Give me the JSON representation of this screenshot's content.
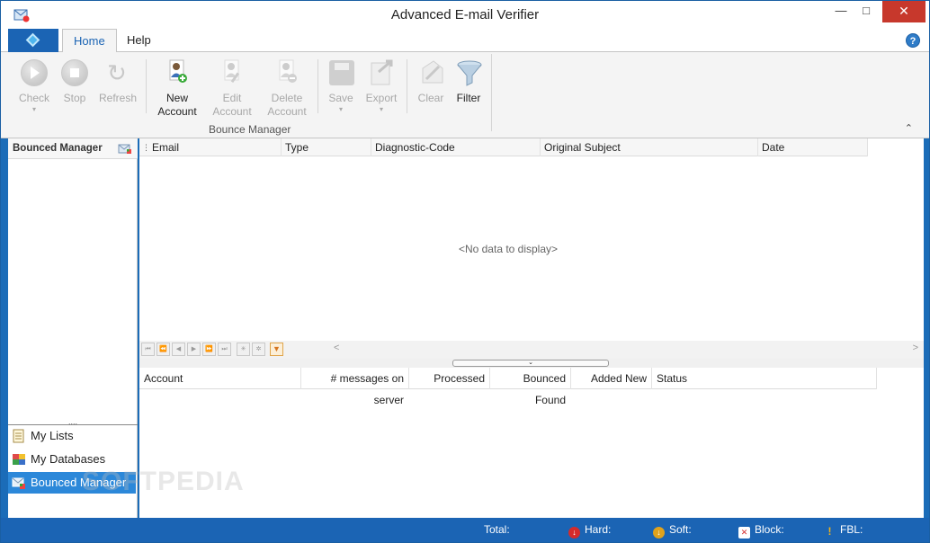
{
  "window": {
    "title": "Advanced E-mail Verifier",
    "min_glyph": "—",
    "max_glyph": "□",
    "close_glyph": "✕"
  },
  "ribbon": {
    "tabs": [
      "Home",
      "Help"
    ],
    "help_glyph": "?",
    "buttons": {
      "check": "Check",
      "stop": "Stop",
      "refresh": "Refresh",
      "new_account_1": "New",
      "new_account_2": "Account",
      "edit_account_1": "Edit",
      "edit_account_2": "Account",
      "delete_account_1": "Delete",
      "delete_account_2": "Account",
      "save": "Save",
      "export": "Export",
      "clear": "Clear",
      "filter": "Filter"
    },
    "group_label": "Bounce Manager",
    "caret_glyph": "▾",
    "collapse_glyph": "⌃"
  },
  "left_panel": {
    "header": "Bounced Manager",
    "grip": "....",
    "nav": [
      {
        "label": "My Lists",
        "icon": "list-icon"
      },
      {
        "label": "My Databases",
        "icon": "database-icon"
      },
      {
        "label": "Bounced Manager",
        "icon": "bounced-mail-icon",
        "active": true
      }
    ]
  },
  "main_grid": {
    "columns": [
      "Email",
      "Type",
      "Diagnostic-Code",
      "Original Subject",
      "Date"
    ],
    "empty_text": "<No data to display>",
    "pager_buttons": [
      "⏮",
      "⏪",
      "◀",
      "▶",
      "⏩",
      "⏭",
      "✳",
      "✲",
      "▼"
    ],
    "scroll_left": "<",
    "scroll_right": ">"
  },
  "splitter": {
    "glyph": "⌄"
  },
  "bottom_grid": {
    "columns": [
      "Account",
      "# messages on server",
      "Processed",
      "Bounced Found",
      "Added New",
      "Status"
    ]
  },
  "watermark": "SOFTPEDIA",
  "status_bar": {
    "total": "Total:",
    "hard": "Hard:",
    "soft": "Soft:",
    "block": "Block:",
    "fbl": "FBL:",
    "hard_glyph": "↓",
    "soft_glyph": "↓",
    "block_glyph": "✕",
    "fbl_glyph": "!"
  },
  "colors": {
    "accent": "#1b64b4",
    "active_nav": "#2c88d9",
    "close_button": "#c7382c",
    "hard": "#d52b2b",
    "soft": "#e0a21c",
    "block": "#d52b2b",
    "fbl": "#f0b21a"
  }
}
